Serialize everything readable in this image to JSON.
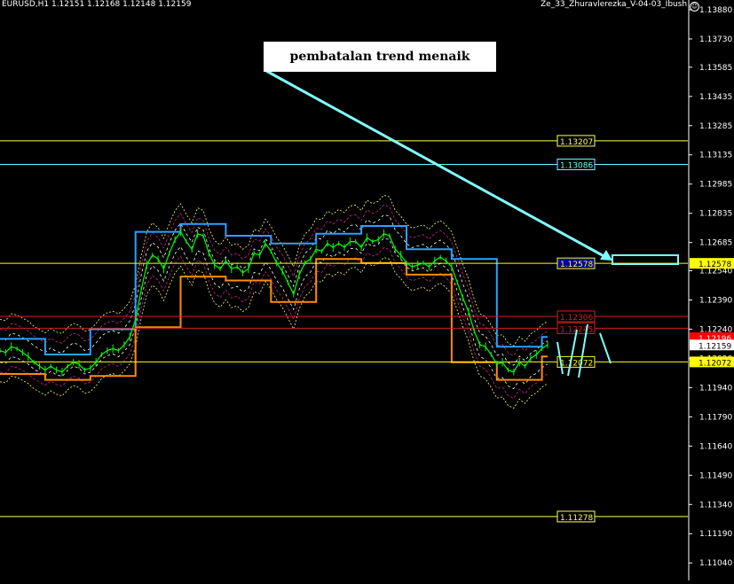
{
  "header": {
    "symbol_info": "EURUSD,H1  1.12151 1.12168 1.12148 1.12159",
    "indicator_name": "Ze_33_Zhuravlerezka_V-04-03_Ibush",
    "smiley_icon": "smiley-icon"
  },
  "annotation": {
    "text": "pembatalan trend menaik",
    "arrow_color": "#80ffff"
  },
  "colors": {
    "background": "#000000",
    "price_line": "#00ff00",
    "upper_channel": "#29a3ff",
    "lower_channel": "#ff8c00",
    "level_yellow": "#ffff66",
    "level_cyan": "#66ffff",
    "level_red": "#cc1111",
    "envelope_white": "#ffffff",
    "envelope_magenta": "#cc2288",
    "envelope_yellow": "#ffff66"
  },
  "chart_data": {
    "type": "line",
    "symbol": "EURUSD",
    "timeframe": "H1",
    "ohlc_last": {
      "open": 1.12151,
      "high": 1.12168,
      "low": 1.12148,
      "close": 1.12159
    },
    "ylim": [
      1.1095,
      1.1393
    ],
    "y_ticks": [
      "1.13880",
      "1.13730",
      "1.13585",
      "1.13435",
      "1.13285",
      "1.13135",
      "1.12985",
      "1.12835",
      "1.12685",
      "1.12540",
      "1.12390",
      "1.12240",
      "1.12090",
      "1.11940",
      "1.11790",
      "1.11640",
      "1.11490",
      "1.11340",
      "1.11190",
      "1.11040"
    ],
    "y_tick_values": [
      1.1388,
      1.1373,
      1.13585,
      1.13435,
      1.13285,
      1.13135,
      1.12985,
      1.12835,
      1.12685,
      1.1254,
      1.1239,
      1.1224,
      1.1209,
      1.1194,
      1.1179,
      1.1164,
      1.1149,
      1.1134,
      1.1119,
      1.1104
    ],
    "levels": [
      {
        "label": "1.13207",
        "value": 1.13207,
        "color": "#ffff66",
        "bg": "#000000",
        "border": "#ffff66"
      },
      {
        "label": "1.13086",
        "value": 1.13086,
        "color": "#66ffff",
        "bg": "#000000",
        "border": "#66ffff"
      },
      {
        "label": "1.12578",
        "value": 1.12578,
        "color": "#ffff00",
        "bg": "#0000aa",
        "border": "#ffff00"
      },
      {
        "label": "1.12306",
        "value": 1.12306,
        "color": "#cc2222",
        "bg": "#000000",
        "border": "#cc2222"
      },
      {
        "label": "1.12245",
        "value": 1.12245,
        "color": "#cc2222",
        "bg": "#000000",
        "border": "#cc2222"
      },
      {
        "label": "1.12072",
        "value": 1.12072,
        "color": "#ffff00",
        "bg": "#000000",
        "border": "#ffff00"
      },
      {
        "label": "1.11278",
        "value": 1.11278,
        "color": "#ffff66",
        "bg": "#000000",
        "border": "#ffff66"
      }
    ],
    "axis_labels": [
      {
        "label": "1.12578",
        "value": 1.12578,
        "bg": "#ffff00",
        "color": "#000000"
      },
      {
        "label": "1.12196",
        "value": 1.12196,
        "bg": "#ff0000",
        "color": "#ffffff"
      },
      {
        "label": "1.12159",
        "value": 1.12159,
        "bg": "#ffffff",
        "color": "#000000"
      },
      {
        "label": "1.12072",
        "value": 1.12072,
        "bg": "#ffff00",
        "color": "#000000"
      }
    ],
    "series": [
      {
        "name": "",
        "values": [
          1.1213,
          1.1212,
          1.1215,
          1.1214,
          1.1212,
          1.121,
          1.1207,
          1.1205,
          1.1203,
          1.1205,
          1.1203,
          1.1202,
          1.1205,
          1.1207,
          1.1206,
          1.1203,
          1.1204,
          1.1207,
          1.1211,
          1.1213,
          1.1214,
          1.1213,
          1.1216,
          1.122,
          1.1229,
          1.1244,
          1.1257,
          1.1262,
          1.126,
          1.1255,
          1.1263,
          1.127,
          1.1274,
          1.1269,
          1.1265,
          1.1273,
          1.1272,
          1.1263,
          1.1257,
          1.1255,
          1.1259,
          1.1255,
          1.1256,
          1.1253,
          1.1255,
          1.1263,
          1.1262,
          1.1268,
          1.1264,
          1.1258,
          1.1254,
          1.1248,
          1.1242,
          1.1252,
          1.1258,
          1.126,
          1.1265,
          1.1264,
          1.1268,
          1.1266,
          1.1268,
          1.1266,
          1.1269,
          1.1269,
          1.1266,
          1.1271,
          1.1269,
          1.127,
          1.1273,
          1.1272,
          1.1265,
          1.1262,
          1.1258,
          1.1256,
          1.1257,
          1.1258,
          1.1256,
          1.1259,
          1.1261,
          1.1259,
          1.1256,
          1.1248,
          1.124,
          1.1233,
          1.1223,
          1.1216,
          1.1215,
          1.1211,
          1.1206,
          1.1207,
          1.1203,
          1.1202,
          1.1207,
          1.1205,
          1.1209,
          1.1211,
          1.1214,
          1.1216
        ]
      }
    ],
    "grid": false,
    "legend": "none"
  }
}
